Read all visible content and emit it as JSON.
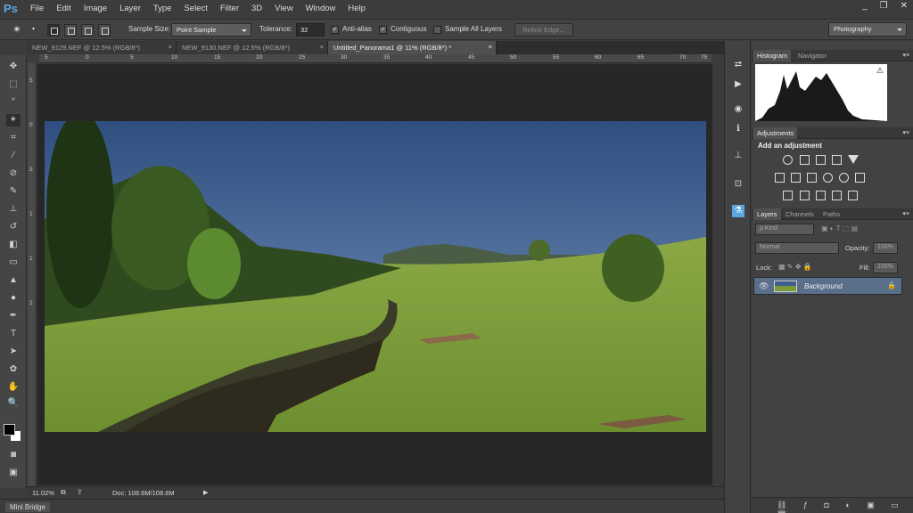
{
  "app": {
    "logo": "Ps",
    "window_controls": [
      "_",
      "❐",
      "✕"
    ]
  },
  "menu": [
    "File",
    "Edit",
    "Image",
    "Layer",
    "Type",
    "Select",
    "Filter",
    "3D",
    "View",
    "Window",
    "Help"
  ],
  "options": {
    "sample_size_label": "Sample Size:",
    "sample_size_value": "Point Sample",
    "tolerance_label": "Tolerance:",
    "tolerance_value": "32",
    "anti_alias": "Anti-alias",
    "contiguous": "Contiguous",
    "sample_all_layers": "Sample All Layers",
    "refine_edge": "Refine Edge...",
    "workspace": "Photography"
  },
  "tabs": [
    {
      "label": "NEW_9129.NEF @ 12.5% (RGB/8*)",
      "close": "×"
    },
    {
      "label": "NEW_9130.NEF @ 12.5% (RGB/8*)",
      "close": "×"
    },
    {
      "label": "Untitled_Panorama1 @ 11% (RGB/8*) *",
      "close": "×"
    }
  ],
  "ruler_h": [
    "5",
    "0",
    "5",
    "10",
    "15",
    "20",
    "25",
    "30",
    "35",
    "40",
    "45",
    "50",
    "55",
    "60",
    "65",
    "70",
    "75"
  ],
  "ruler_v": [
    "5",
    "0",
    "5",
    "1",
    "1",
    "2"
  ],
  "status": {
    "zoom": "11.02%",
    "doc": "Doc: 108.6M/108.6M",
    "arrow": "▶"
  },
  "mini_bridge": "Mini Bridge",
  "histogram": {
    "tab": "Histogram",
    "tab2": "Navigator",
    "warning": "⚠"
  },
  "adjustments": {
    "tab": "Adjustments",
    "heading": "Add an adjustment"
  },
  "layers": {
    "tabs": [
      "Layers",
      "Channels",
      "Paths"
    ],
    "kind": "ρ Kind",
    "blend": "Normal",
    "opacity_label": "Opacity:",
    "opacity_value": "100%",
    "lock_label": "Lock:",
    "fill_label": "Fill:",
    "fill_value": "100%",
    "layer_name": "Background"
  },
  "colors": {
    "accent": "#5aa7e0",
    "selected_layer": "#5a6f8a",
    "sky_top": "#3d5e8f",
    "grass": "#7a9a3a"
  }
}
